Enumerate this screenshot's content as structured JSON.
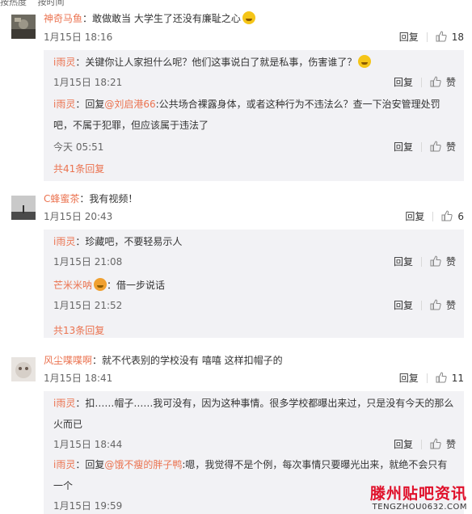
{
  "top": {
    "left": "按热度",
    "right": "按时间"
  },
  "comments": [
    {
      "user": "神奇马鱼",
      "text": "：敢做敢当 大学生了还没有廉耻之心",
      "time": "1月15日 18:16",
      "reply": "回复",
      "likes": "18",
      "replies": [
        {
          "user": "i雨灵",
          "text": "：关键你让人家担什么呢？他们这事说白了就是私事，伤害谁了？",
          "time": "1月15日 18:21",
          "reply": "回复",
          "like": "赞"
        },
        {
          "user": "i雨灵",
          "pre": "：回复",
          "mention": "@刘启港66",
          "text": ":公共场合裸露身体，或者这种行为不违法么？查一下治安管理处罚吧，不属于犯罪，但应该属于违法了",
          "time": "今天 05:51",
          "reply": "回复",
          "like": "赞"
        }
      ],
      "more": "共41条回复"
    },
    {
      "user": "C蜂蜜茶",
      "text": "：我有视频！",
      "time": "1月15日 20:43",
      "reply": "回复",
      "likes": "6",
      "replies": [
        {
          "user": "i雨灵",
          "text": "：珍藏吧，不要轻易示人",
          "time": "1月15日 21:08",
          "reply": "回复",
          "like": "赞"
        },
        {
          "user": "芒米米呐",
          "text": "：借一步说话",
          "time": "1月15日 21:52",
          "reply": "回复",
          "like": "赞"
        }
      ],
      "more": "共13条回复"
    },
    {
      "user": "风尘喋喋啊",
      "text": "：就不代表别的学校没有 嘻嘻 这样扣帽子的",
      "time": "1月15日 18:41",
      "reply": "回复",
      "likes": "11",
      "replies": [
        {
          "user": "i雨灵",
          "text": "：扣……帽子……我可没有，因为这种事情。很多学校都曝出来过，只是没有今天的那么火而已",
          "time": "1月15日 18:44",
          "reply": "回复",
          "like": "赞"
        },
        {
          "user": "i雨灵",
          "pre": "：回复",
          "mention": "@饿不瘦的胖子鸭",
          "text": ":嗯，我觉得不是个例，每次事情只要曝光出来，就绝不会只有一个",
          "time": "1月15日 19:59",
          "reply": "回复",
          "like": "赞"
        }
      ]
    }
  ],
  "watermark": {
    "title": "滕州贴吧资讯",
    "sub": "TENGZHOU0632.COM"
  }
}
